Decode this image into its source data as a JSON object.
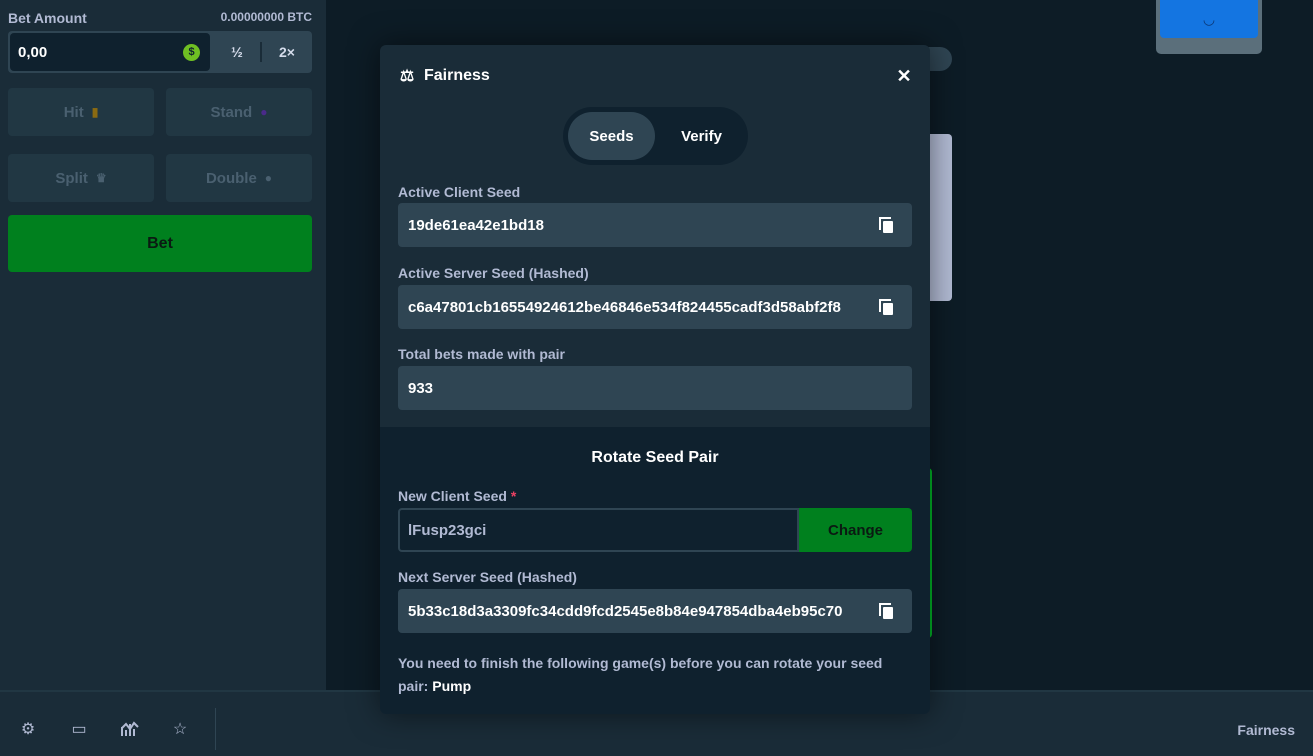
{
  "sidebar": {
    "bet_amount_label": "Bet Amount",
    "bet_amount_btc": "0.00000000 BTC",
    "bet_amount_value": "0,00",
    "coin_symbol": "$",
    "half_label": "½",
    "double_label": "2×",
    "hit_label": "Hit",
    "stand_label": "Stand",
    "split_label": "Split",
    "double_action_label": "Double",
    "bet_button_label": "Bet"
  },
  "bottom_bar": {
    "fairness_label": "Fairness",
    "icons": [
      "gear-icon",
      "theatre-icon",
      "stats-icon",
      "star-icon"
    ]
  },
  "modal": {
    "title": "Fairness",
    "tabs": [
      {
        "label": "Seeds",
        "active": true
      },
      {
        "label": "Verify",
        "active": false
      }
    ],
    "active_client_seed_label": "Active Client Seed",
    "active_client_seed": "19de61ea42e1bd18",
    "active_server_seed_label": "Active Server Seed (Hashed)",
    "active_server_seed": "c6a47801cb16554924612be46846e534f824455cadf3d58abf2f8",
    "total_bets_label": "Total bets made with pair",
    "total_bets": "933",
    "rotate_title": "Rotate Seed Pair",
    "new_client_seed_label": "New Client Seed",
    "required_mark": "*",
    "new_client_seed_value": "lFusp23gci",
    "change_button": "Change",
    "next_server_seed_label": "Next Server Seed (Hashed)",
    "next_server_seed": "5b33c18d3a3309fc34cdd9fcd2545e8b84e947854dba4eb95c70",
    "note_text": "You need to finish the following game(s) before you can rotate your seed pair: ",
    "note_game": "Pump"
  },
  "colors": {
    "background": "#0d1c26",
    "panel": "#1a2c38",
    "input": "#2f4553",
    "accent_green": "#00801e",
    "required_red": "#ed4163"
  }
}
